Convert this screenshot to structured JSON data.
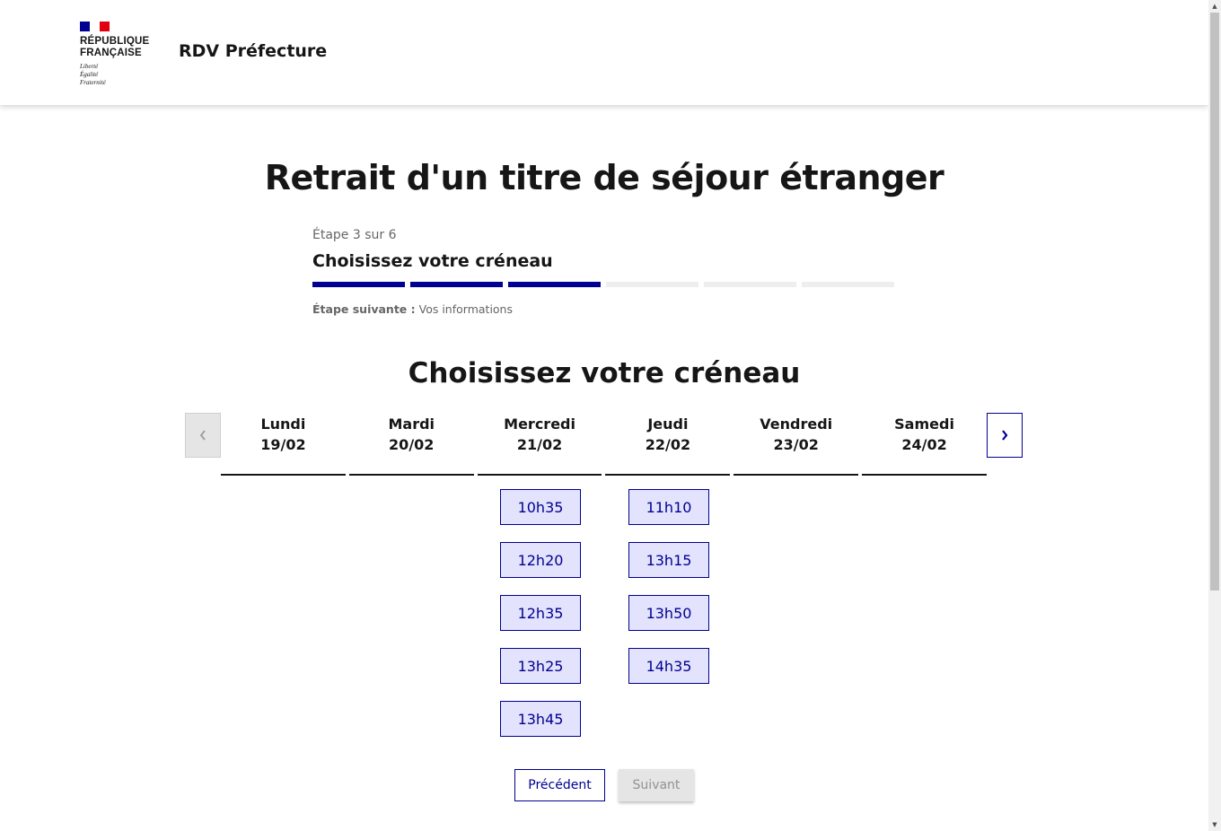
{
  "header": {
    "logo_name": "RÉPUBLIQUE\nFRANÇAISE",
    "logo_motto": "Liberté\nÉgalité\nFraternité",
    "service_title": "RDV Préfecture"
  },
  "page": {
    "title": "Retrait d'un titre de séjour étranger"
  },
  "stepper": {
    "state": "Étape 3 sur 6",
    "current_step": 3,
    "total_steps": 6,
    "title": "Choisissez votre créneau",
    "next_label": "Étape suivante :",
    "next_value": "Vos informations"
  },
  "calendar": {
    "title": "Choisissez votre créneau",
    "prev_icon": "chevron-left-icon",
    "next_icon": "chevron-right-icon",
    "days": [
      {
        "name": "Lundi",
        "date": "19/02",
        "slots": []
      },
      {
        "name": "Mardi",
        "date": "20/02",
        "slots": []
      },
      {
        "name": "Mercredi",
        "date": "21/02",
        "slots": [
          "10h35",
          "12h20",
          "12h35",
          "13h25",
          "13h45"
        ]
      },
      {
        "name": "Jeudi",
        "date": "22/02",
        "slots": [
          "11h10",
          "13h15",
          "13h50",
          "14h35"
        ]
      },
      {
        "name": "Vendredi",
        "date": "23/02",
        "slots": []
      },
      {
        "name": "Samedi",
        "date": "24/02",
        "slots": []
      }
    ]
  },
  "actions": {
    "previous_label": "Précédent",
    "next_label": "Suivant",
    "next_disabled": true
  },
  "colors": {
    "primary": "#000091",
    "slot_bg": "#e3e3fd",
    "flag_red": "#e1000f",
    "disabled_bg": "#e5e5e5"
  }
}
